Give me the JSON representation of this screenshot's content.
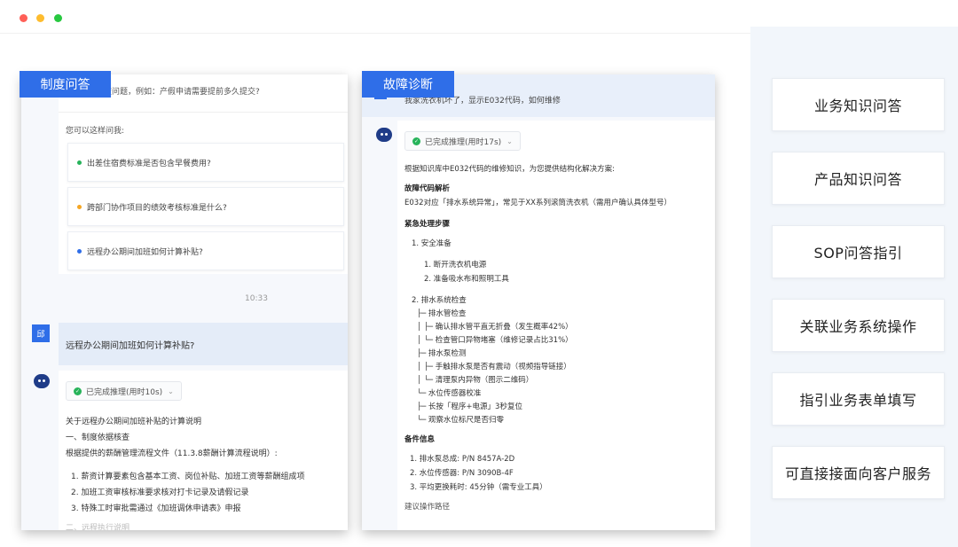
{
  "card1": {
    "tag": "制度问答",
    "top_question": "…请有关制度问题，例如：产假申请需要提前多久提交?",
    "hint": "您可以这样问我:",
    "suggestions": [
      {
        "text": "出差住宿费标准是否包含早餐费用?",
        "bullet_color": "#27b35a"
      },
      {
        "text": "跨部门协作项目的绩效考核标准是什么?",
        "bullet_color": "#f5a623"
      },
      {
        "text": "远程办公期间加班如何计算补贴?",
        "bullet_color": "#2f6ee8"
      }
    ],
    "time": "10:33",
    "user_avatar": "邱",
    "user_message": "远程办公期间加班如何计算补贴?",
    "status": "已完成推理(用时10s)",
    "answer_lines": [
      {
        "text": "关于远程办公期间加班补贴的计算说明",
        "bold": false
      },
      {
        "text": "一、制度依据核查",
        "bold": false
      },
      {
        "text": "根据提供的薪酬管理流程文件（11.3.8薪酬计算流程说明）:",
        "bold": false
      },
      {
        "text": "1. 薪资计算要素包含基本工资、岗位补贴、加班工资等薪酬组成项",
        "bold": false
      },
      {
        "text": "2. 加班工资审核标准要求核对打卡记录及请假记录",
        "bold": false
      },
      {
        "text": "3. 特殊工时审批需通过《加班调休申请表》申报",
        "bold": false
      },
      {
        "text": "二、远程执行说明",
        "bold": false
      }
    ]
  },
  "card2": {
    "tag": "故障诊断",
    "question": "我家洗衣机坏了，显示E032代码，如何维修",
    "status": "已完成推理(用时17s)",
    "lines": [
      {
        "text": "根据知识库中E032代码的维修知识，为您提供结构化解决方案:",
        "bold": false
      },
      {
        "text": "故障代码解析",
        "bold": true
      },
      {
        "text": "E032对应「排水系统异常」，常见于XX系列滚筒洗衣机（需用户确认具体型号）",
        "bold": false
      },
      {
        "text": "紧急处理步骤",
        "bold": true
      },
      {
        "text": "1. 安全准备",
        "bold": false
      },
      {
        "text": "1. 断开洗衣机电源",
        "bold": false
      },
      {
        "text": "2. 准备吸水布和照明工具",
        "bold": false
      },
      {
        "text": "2. 排水系统检查",
        "bold": false
      },
      {
        "text": "├─ 排水管检查",
        "bold": false
      },
      {
        "text": "│  ├─ 确认排水管平直无折叠（发生概率42%）",
        "bold": false
      },
      {
        "text": "│  └─ 检查管口异物堵塞（维修记录占比31%）",
        "bold": false
      },
      {
        "text": "├─ 排水泵检测",
        "bold": false
      },
      {
        "text": "│  ├─ 手触排水泵是否有震动（视频指导链接）",
        "bold": false
      },
      {
        "text": "│  └─ 清理泵内异物（图示二维码）",
        "bold": false
      },
      {
        "text": "└─ 水位传感器校准",
        "bold": false
      },
      {
        "text": "├─ 长按「程序+电源」3秒复位",
        "bold": false
      },
      {
        "text": "└─ 观察水位标尺是否归零",
        "bold": false
      },
      {
        "text": "备件信息",
        "bold": true
      },
      {
        "text": "1. 排水泵总成: P/N 8457A-2D",
        "bold": false
      },
      {
        "text": "2. 水位传感器: P/N 3090B-4F",
        "bold": false
      },
      {
        "text": "3. 平均更换耗时: 45分钟（需专业工具）",
        "bold": false
      },
      {
        "text": "建议操作路径",
        "bold": false
      }
    ]
  },
  "features": [
    "业务知识问答",
    "产品知识问答",
    "SOP问答指引",
    "关联业务系统操作",
    "指引业务表单填写",
    "可直接接面向客户服务"
  ]
}
